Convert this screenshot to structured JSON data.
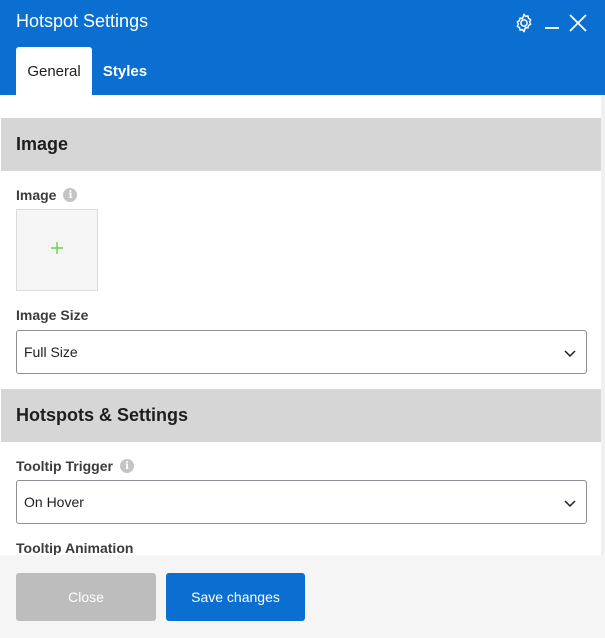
{
  "window": {
    "title": "Hotspot Settings",
    "icons": {
      "settings": "gear-icon",
      "minimize": "minimize-icon",
      "close": "close-icon"
    }
  },
  "tabs": [
    {
      "label": "General",
      "active": true
    },
    {
      "label": "Styles",
      "active": false
    }
  ],
  "sections": {
    "image": {
      "title": "Image",
      "image_field": {
        "label": "Image",
        "picker_glyph": "+"
      },
      "image_size": {
        "label": "Image Size",
        "value": "Full Size"
      }
    },
    "hotspots": {
      "title": "Hotspots & Settings",
      "tooltip_trigger": {
        "label": "Tooltip Trigger",
        "value": "On Hover"
      },
      "tooltip_animation": {
        "label": "Tooltip Animation"
      }
    }
  },
  "info_glyph": "i",
  "footer": {
    "close_label": "Close",
    "save_label": "Save changes"
  },
  "colors": {
    "accent": "#0a6fd0",
    "section_bg": "#d6d6d6",
    "plus_green": "#6fcf4f",
    "disabled_button": "#bdbdbd"
  }
}
